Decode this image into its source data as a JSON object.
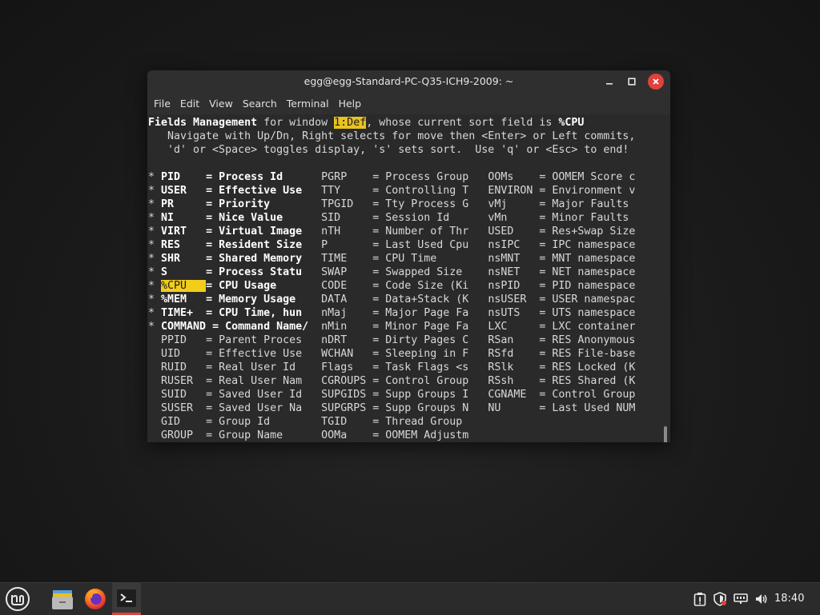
{
  "window": {
    "title": "egg@egg-Standard-PC-Q35-ICH9-2009: ~"
  },
  "menu": [
    "File",
    "Edit",
    "View",
    "Search",
    "Terminal",
    "Help"
  ],
  "terminal": {
    "header": {
      "p1": "Fields Management",
      "p2": " for window ",
      "window_name": "1:Def",
      "p3": ", whose current sort field is ",
      "sort_field": "%CPU",
      "help1": "   Navigate with Up/Dn, Right selects for move then <Enter> or Left commits,",
      "help2": "   'd' or <Space> toggles display, 's' sets sort.  Use 'q' or <Esc> to end!"
    },
    "rows": [
      {
        "m": "* ",
        "f1": "PID    ",
        "d1": "= Process Id      ",
        "c2": "PGRP    = Process Group   ",
        "c3": "OOMs    = OOMEM Score c",
        "on": true
      },
      {
        "m": "* ",
        "f1": "USER   ",
        "d1": "= Effective Use   ",
        "c2": "TTY     = Controlling T   ",
        "c3": "ENVIRON = Environment v",
        "on": true
      },
      {
        "m": "* ",
        "f1": "PR     ",
        "d1": "= Priority        ",
        "c2": "TPGID   = Tty Process G   ",
        "c3": "vMj     = Major Faults",
        "on": true
      },
      {
        "m": "* ",
        "f1": "NI     ",
        "d1": "= Nice Value      ",
        "c2": "SID     = Session Id      ",
        "c3": "vMn     = Minor Faults",
        "on": true
      },
      {
        "m": "* ",
        "f1": "VIRT   ",
        "d1": "= Virtual Image   ",
        "c2": "nTH     = Number of Thr   ",
        "c3": "USED    = Res+Swap Size",
        "on": true
      },
      {
        "m": "* ",
        "f1": "RES    ",
        "d1": "= Resident Size   ",
        "c2": "P       = Last Used Cpu   ",
        "c3": "nsIPC   = IPC namespace",
        "on": true
      },
      {
        "m": "* ",
        "f1": "SHR    ",
        "d1": "= Shared Memory   ",
        "c2": "TIME    = CPU Time        ",
        "c3": "nsMNT   = MNT namespace",
        "on": true
      },
      {
        "m": "* ",
        "f1": "S      ",
        "d1": "= Process Statu   ",
        "c2": "SWAP    = Swapped Size    ",
        "c3": "nsNET   = NET namespace",
        "on": true
      },
      {
        "m": "* ",
        "f1": "%CPU   ",
        "d1": "= CPU Usage       ",
        "c2": "CODE    = Code Size (Ki   ",
        "c3": "nsPID   = PID namespace",
        "on": true,
        "sel": true
      },
      {
        "m": "* ",
        "f1": "%MEM   ",
        "d1": "= Memory Usage    ",
        "c2": "DATA    = Data+Stack (K   ",
        "c3": "nsUSER  = USER namespac",
        "on": true
      },
      {
        "m": "* ",
        "f1": "TIME+  ",
        "d1": "= CPU Time, hun   ",
        "c2": "nMaj    = Major Page Fa   ",
        "c3": "nsUTS   = UTS namespace",
        "on": true
      },
      {
        "m": "* ",
        "f1": "COMMAND",
        "d1": " = Command Name/  ",
        "c2": "nMin    = Minor Page Fa   ",
        "c3": "LXC     = LXC container",
        "on": true
      },
      {
        "m": "  ",
        "f1": "PPID   ",
        "d1": "= Parent Proces   ",
        "c2": "nDRT    = Dirty Pages C   ",
        "c3": "RSan    = RES Anonymous",
        "on": false
      },
      {
        "m": "  ",
        "f1": "UID    ",
        "d1": "= Effective Use   ",
        "c2": "WCHAN   = Sleeping in F   ",
        "c3": "RSfd    = RES File-base",
        "on": false
      },
      {
        "m": "  ",
        "f1": "RUID   ",
        "d1": "= Real User Id    ",
        "c2": "Flags   = Task Flags <s   ",
        "c3": "RSlk    = RES Locked (K",
        "on": false
      },
      {
        "m": "  ",
        "f1": "RUSER  ",
        "d1": "= Real User Nam   ",
        "c2": "CGROUPS = Control Group   ",
        "c3": "RSsh    = RES Shared (K",
        "on": false
      },
      {
        "m": "  ",
        "f1": "SUID   ",
        "d1": "= Saved User Id   ",
        "c2": "SUPGIDS = Supp Groups I   ",
        "c3": "CGNAME  = Control Group",
        "on": false
      },
      {
        "m": "  ",
        "f1": "SUSER  ",
        "d1": "= Saved User Na   ",
        "c2": "SUPGRPS = Supp Groups N   ",
        "c3": "NU      = Last Used NUM",
        "on": false
      },
      {
        "m": "  ",
        "f1": "GID    ",
        "d1": "= Group Id        ",
        "c2": "TGID    = Thread Group    ",
        "c3": "",
        "on": false
      },
      {
        "m": "  ",
        "f1": "GROUP  ",
        "d1": "= Group Name      ",
        "c2": "OOMa    = OOMEM Adjustm   ",
        "c3": "",
        "on": false
      }
    ]
  },
  "taskbar": {
    "clock": "18:40",
    "apps": [
      "mint-menu-icon",
      "files-icon",
      "firefox-icon",
      "terminal-icon"
    ],
    "tray": [
      "update-manager-icon",
      "shield-icon",
      "network-icon",
      "volume-icon"
    ]
  },
  "colors": {
    "highlight": "#e8c21f",
    "close_button": "#e0413c",
    "terminal_bg": "#2a2a2a"
  }
}
